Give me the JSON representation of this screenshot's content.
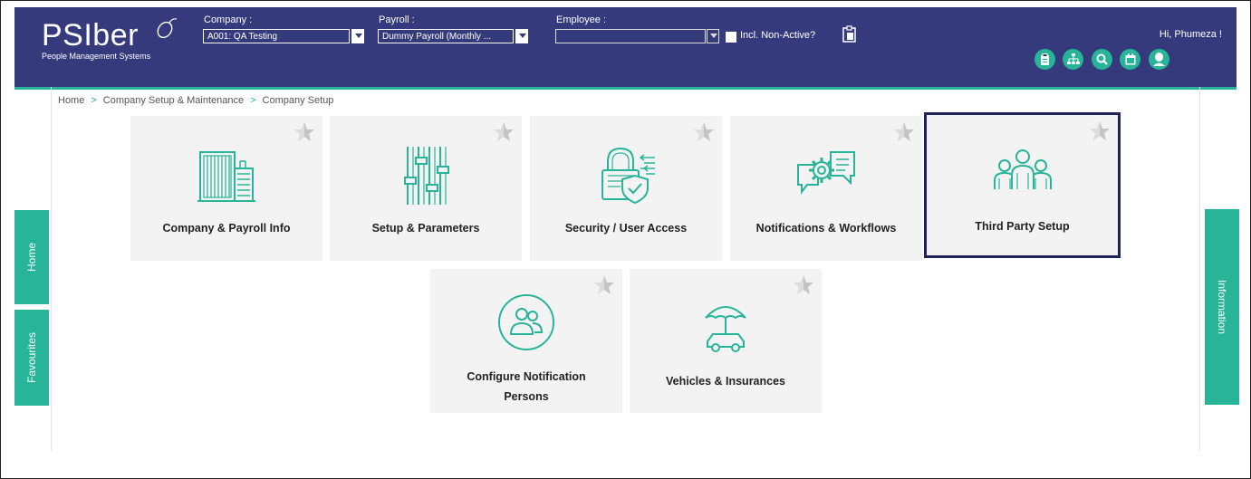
{
  "header": {
    "logo": "PSIber",
    "logo_sub": "People Management Systems",
    "company_label": "Company :",
    "company_value": "A001: QA Testing",
    "payroll_label": "Payroll :",
    "payroll_value": "Dummy Payroll  (Monthly ...",
    "employee_label": "Employee :",
    "employee_value": "",
    "incl_nonactive_label": "Incl. Non-Active?",
    "greeting": "Hi, Phumeza !",
    "icons": [
      "clipboard-icon",
      "org-chart-icon",
      "search-icon",
      "calendar-icon",
      "user-icon"
    ]
  },
  "breadcrumb": {
    "home": "Home",
    "sep": ">",
    "level2": "Company Setup & Maintenance",
    "level3": "Company Setup"
  },
  "tiles": [
    {
      "label": "Company & Payroll Info",
      "icon": "building-icon"
    },
    {
      "label": "Setup & Parameters",
      "icon": "sliders-icon"
    },
    {
      "label": "Security / User Access",
      "icon": "lock-shield-icon"
    },
    {
      "label": "Notifications & Workflows",
      "icon": "gear-chat-icon"
    },
    {
      "label": "Third Party Setup",
      "icon": "people-group-icon",
      "selected": true
    },
    {
      "label_line1": "Configure Notification",
      "label_line2": "Persons",
      "icon": "persons-circle-icon"
    },
    {
      "label": "Vehicles & Insurances",
      "icon": "car-umbrella-icon"
    }
  ],
  "side_tabs": {
    "home": "Home",
    "favourites": "Favourites",
    "information": "Information"
  },
  "colors": {
    "header_bg": "#353a7c",
    "accent": "#27b498",
    "tile_bg": "#f3f3f3",
    "selected_border": "#1e2453"
  }
}
